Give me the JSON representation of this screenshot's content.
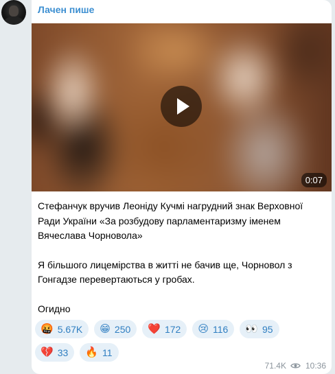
{
  "channel": {
    "author_name": "Лачен пише"
  },
  "video": {
    "duration": "0:07"
  },
  "message": {
    "paragraphs": [
      "Стефанчук вручив Леоніду Кучмі нагрудний знак Верховної Ради України «За розбудову парламентаризму іменем Вячеслава Чорновола»",
      "Я більшого лицемірства в житті не бачив ще, Чорновол з Гонгадзе перевертаються у гробах.",
      "Огидно"
    ]
  },
  "reactions": [
    {
      "emoji": "🤬",
      "count": "5.67K"
    },
    {
      "emoji": "😁",
      "count": "250"
    },
    {
      "emoji": "❤️",
      "count": "172"
    },
    {
      "emoji": "😢",
      "count": "116"
    },
    {
      "emoji": "👀",
      "count": "95"
    },
    {
      "emoji": "💔",
      "count": "33"
    },
    {
      "emoji": "🔥",
      "count": "11"
    }
  ],
  "meta": {
    "views": "71.4K",
    "time": "10:36"
  },
  "colors": {
    "author": "#3d8fd1",
    "reaction_bg": "#e6f0f8",
    "reaction_text": "#2f7ec1",
    "meta_text": "#8b949c"
  }
}
